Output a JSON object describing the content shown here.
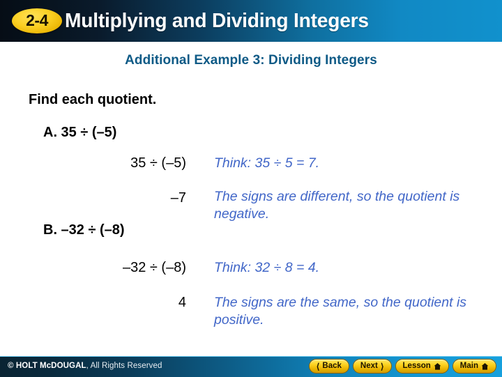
{
  "header": {
    "badge": "2-4",
    "title": "Multiplying and Dividing Integers"
  },
  "slide": {
    "subtitle": "Additional Example 3: Dividing Integers",
    "prompt": "Find each quotient.",
    "parts": [
      {
        "label": "A. 35 ÷ (–5)",
        "steps": [
          {
            "expression": "35 ÷ (–5)",
            "note": "Think: 35 ÷ 5 = 7."
          },
          {
            "expression": "–7",
            "note": "The signs are different, so the quotient is negative."
          }
        ]
      },
      {
        "label": "B. –32 ÷ (–8)",
        "steps": [
          {
            "expression": "–32 ÷ (–8)",
            "note": "Think: 32 ÷ 8 = 4."
          },
          {
            "expression": "4",
            "note": "The signs are the same, so the quotient is positive."
          }
        ]
      }
    ]
  },
  "footer": {
    "copyright_brand": "© HOLT McDOUGAL",
    "copyright_rest": ", All Rights Reserved",
    "buttons": [
      {
        "label": "Back",
        "icon": "chevron-left-icon"
      },
      {
        "label": "Next",
        "icon": "chevron-right-icon"
      },
      {
        "label": "Lesson",
        "icon": "home-icon"
      },
      {
        "label": "Main",
        "icon": "home-icon"
      }
    ]
  },
  "colors": {
    "header_dark": "#060d16",
    "header_blue": "#1191cd",
    "subtitle": "#0e5a86",
    "note_blue": "#4267c8",
    "badge_gold": "#fcd024"
  }
}
